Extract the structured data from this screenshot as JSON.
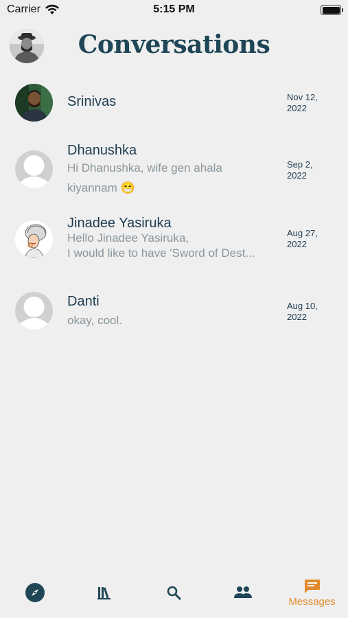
{
  "status_bar": {
    "carrier": "Carrier",
    "time": "5:15 PM",
    "battery_level": 1.0
  },
  "header": {
    "title": "Conversations",
    "profile_icon": "user-photo"
  },
  "conversations": [
    {
      "name": "Srinivas",
      "preview": "",
      "date": "Nov 12,\n2022",
      "avatar": "photo"
    },
    {
      "name": "Dhanushka",
      "preview": "Hi Dhanushka, wife gen ahala\nkiyannam 😁",
      "date": "Sep 2,\n2022",
      "avatar": "default"
    },
    {
      "name": "Jinadee Yasiruka",
      "preview": "Hello Jinadee Yasiruka,\nI would like to have 'Sword of Dest...",
      "date": "Aug 27,\n2022",
      "avatar": "illustration"
    },
    {
      "name": "Danti",
      "preview": "okay, cool.",
      "date": "Aug 10,\n2022",
      "avatar": "default"
    }
  ],
  "tab_bar": {
    "tabs": [
      {
        "icon": "compass-icon",
        "label": ""
      },
      {
        "icon": "library-icon",
        "label": ""
      },
      {
        "icon": "search-icon",
        "label": ""
      },
      {
        "icon": "people-icon",
        "label": ""
      },
      {
        "icon": "message-icon",
        "label": "Messages"
      }
    ],
    "active_index": 4,
    "colors": {
      "active": "#e1892a",
      "inactive": "#1e4656"
    }
  }
}
